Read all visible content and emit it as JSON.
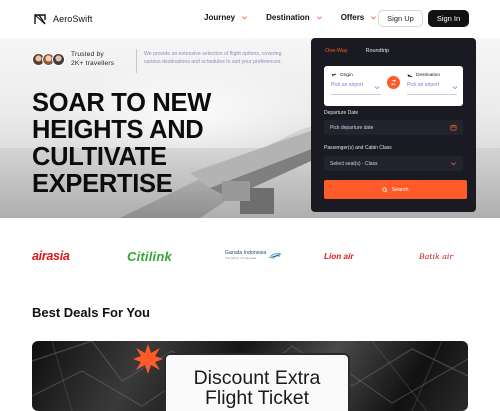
{
  "brand": {
    "name": "AeroSwift",
    "logo_icon": "aeroswift-logo-icon"
  },
  "nav": {
    "menu": [
      {
        "label": "Journey",
        "icon": "chevron-down-icon"
      },
      {
        "label": "Destination",
        "icon": "chevron-down-icon"
      },
      {
        "label": "Offers",
        "icon": "chevron-down-icon"
      }
    ],
    "signup_label": "Sign Up",
    "signin_label": "Sign In"
  },
  "hero": {
    "trust_line1": "Trusted by",
    "trust_line2": "2K+ travellers",
    "blurb": "We provide an extensive selection of flight options, covering various destinations and schedules to suit your preferences.",
    "headline": [
      "SOAR TO NEW",
      "HEIGHTS AND",
      "CULTIVATE",
      "EXPERTISE"
    ]
  },
  "booking": {
    "tabs": [
      {
        "label": "One-Way",
        "active": true
      },
      {
        "label": "Roundtrip",
        "active": false
      }
    ],
    "origin": {
      "label": "Origin",
      "placeholder": "Pick an airport",
      "icon": "plane-takeoff-icon"
    },
    "destination": {
      "label": "Destination",
      "placeholder": "Pick an airport",
      "icon": "plane-landing-icon"
    },
    "swap_icon": "swap-icon",
    "departure": {
      "label": "Departure Date",
      "placeholder": "Pick departure date",
      "icon": "calendar-icon"
    },
    "passengers": {
      "label": "Passenger(s) and Cabin Class",
      "placeholder": "Select seat(s) - Class",
      "icon": "chevron-down-icon"
    },
    "search_label": "Search",
    "search_icon": "search-icon"
  },
  "airlines": [
    {
      "name": "airasia"
    },
    {
      "name": "Citilink"
    },
    {
      "name": "Garuda Indonesia",
      "tagline": "The Airline of Indonesia"
    },
    {
      "name": "Lion air"
    },
    {
      "name": "Batik air"
    }
  ],
  "deals": {
    "title": "Best Deals For You",
    "banner_line1": "Discount Extra",
    "banner_line2": "Flight Ticket"
  },
  "colors": {
    "accent": "#ff5a2a",
    "panel_bg": "#191a22",
    "placeholder": "#7d86c7"
  }
}
